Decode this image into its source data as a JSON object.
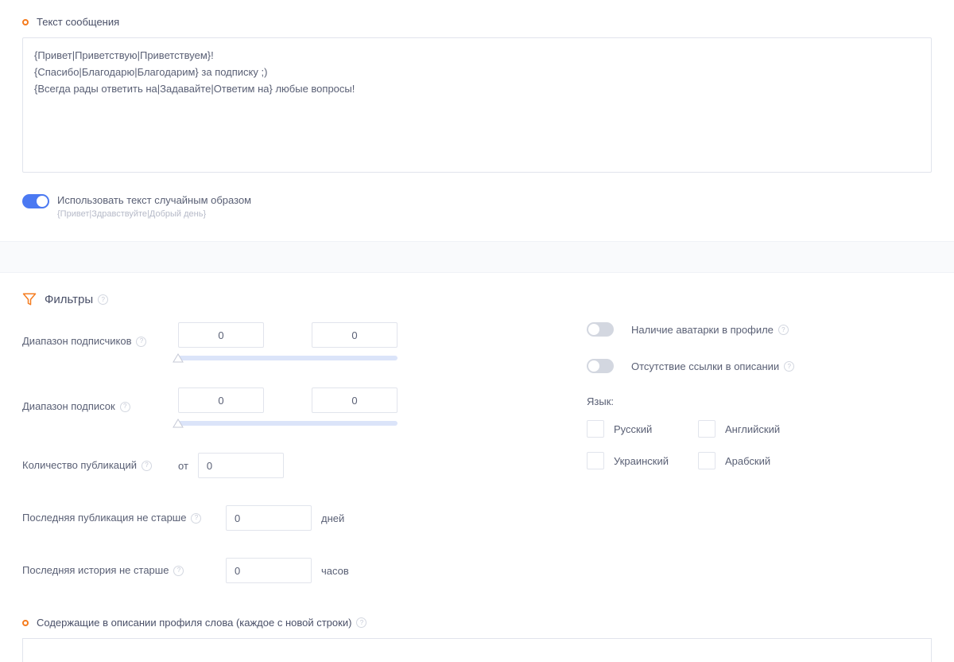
{
  "messageSection": {
    "label": "Текст сообщения",
    "text": "{Привет|Приветствую|Приветствуем}!\n{Спасибо|Благодарю|Благодарим} за подписку ;)\n{Всегда рады ответить на|Задавайте|Ответим на} любые вопросы!",
    "randomToggle": {
      "label": "Использовать текст случайным образом",
      "hint": "{Привет|Здравствуйте|Добрый день}",
      "on": true
    }
  },
  "filters": {
    "title": "Фильтры",
    "subscribersRange": {
      "label": "Диапазон подписчиков",
      "min": "0",
      "max": "0"
    },
    "subscriptionsRange": {
      "label": "Диапазон подписок",
      "min": "0",
      "max": "0"
    },
    "publications": {
      "label": "Количество публикаций",
      "fromLabel": "от",
      "value": "0"
    },
    "lastPublication": {
      "label": "Последняя публикация не старше",
      "value": "0",
      "unit": "дней"
    },
    "lastStory": {
      "label": "Последняя история не старше",
      "value": "0",
      "unit": "часов"
    },
    "avatarToggle": {
      "label": "Наличие аватарки в профиле",
      "on": false
    },
    "noLinkToggle": {
      "label": "Отсутствие ссылки в описании",
      "on": false
    },
    "languageLabel": "Язык:",
    "languages": [
      "Русский",
      "Английский",
      "Украинский",
      "Арабский"
    ]
  },
  "bottomSection": {
    "label": "Содержащие в описании профиля слова (каждое с новой строки)"
  }
}
